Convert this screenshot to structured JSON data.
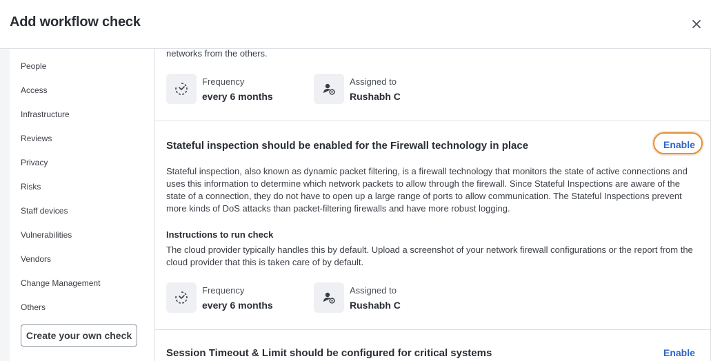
{
  "header": {
    "title": "Add workflow check"
  },
  "sidebar": {
    "items": [
      {
        "label": "People"
      },
      {
        "label": "Access"
      },
      {
        "label": "Infrastructure"
      },
      {
        "label": "Reviews"
      },
      {
        "label": "Privacy"
      },
      {
        "label": "Risks"
      },
      {
        "label": "Staff devices"
      },
      {
        "label": "Vulnerabilities"
      },
      {
        "label": "Vendors"
      },
      {
        "label": "Change Management"
      },
      {
        "label": "Others"
      }
    ],
    "create_button": "Create your own check"
  },
  "checks": [
    {
      "desc_tail": "networks from the others.",
      "frequency_label": "Frequency",
      "frequency_value": "every 6 months",
      "assigned_label": "Assigned to",
      "assigned_value": "Rushabh C"
    },
    {
      "title": "Stateful inspection should be enabled for the Firewall technology in place",
      "enable_label": "Enable",
      "description": "Stateful inspection, also known as dynamic packet filtering, is a firewall technology that monitors the state of active connections and uses this information to determine which network packets to allow through the firewall. Since Stateful Inspections are aware of the state of a connection, they do not have to open up a large range of ports to allow communication. The Stateful Inspections prevent more kinds of DoS attacks than packet-filtering firewalls and have more robust logging.",
      "instructions_heading": "Instructions to run check",
      "instructions": "The cloud provider typically handles this by default. Upload a screenshot of your network firewall configurations or the report from the cloud provider that this is taken care of by default.",
      "frequency_label": "Frequency",
      "frequency_value": "every 6 months",
      "assigned_label": "Assigned to",
      "assigned_value": "Rushabh C"
    },
    {
      "title": "Session Timeout & Limit should be configured for critical systems",
      "enable_label": "Enable"
    }
  ],
  "colors": {
    "accent": "#2f65c6",
    "highlight": "#e0923a"
  },
  "icons": {
    "close": "close-icon",
    "frequency": "frequency-icon",
    "assignee": "user-at-icon"
  }
}
